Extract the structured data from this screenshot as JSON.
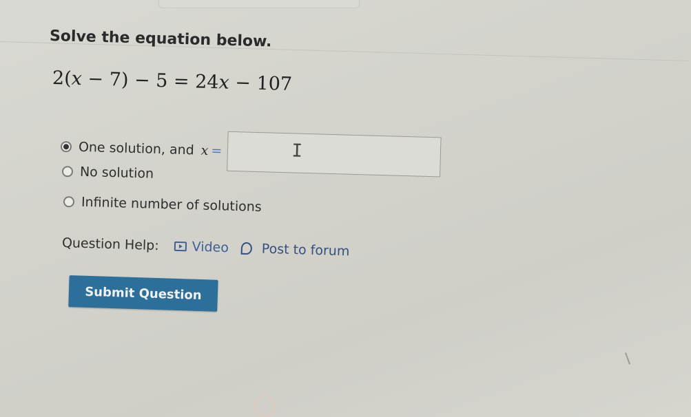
{
  "question": {
    "prompt": "Solve the equation below.",
    "equation": {
      "coef": "2",
      "open_paren": "(",
      "var": "x",
      "minus1": " − ",
      "seven": "7",
      "close_paren": ")",
      "rest": " − 5 = 24",
      "var2": "x",
      "tail": " − 107"
    }
  },
  "options": [
    {
      "label": "One solution, and",
      "selected": true,
      "var": "x",
      "equals": "="
    },
    {
      "label": "No solution",
      "selected": false
    },
    {
      "label": "Infinite number of solutions",
      "selected": false
    }
  ],
  "answer_field": {
    "value": "",
    "cursor_glyph": "I"
  },
  "help": {
    "label": "Question Help:",
    "video_label": "Video",
    "forum_label": "Post to forum"
  },
  "submit": {
    "label": "Submit Question"
  },
  "colors": {
    "button_bg": "#2b6f9a",
    "link": "#3e5f96",
    "background": "#d3d3cc"
  },
  "icons": {
    "video": "video-play-icon",
    "forum": "speech-bubble-icon"
  }
}
